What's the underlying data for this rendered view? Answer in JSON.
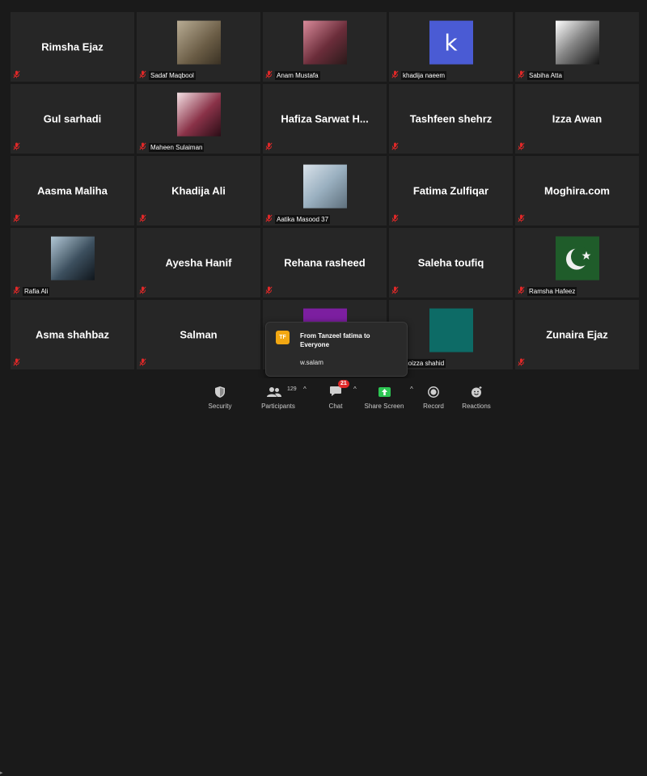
{
  "participants": [
    {
      "name": "Rimsha Ejaz",
      "avatar": null,
      "caption": null
    },
    {
      "name": "Sadaf Maqbool",
      "avatar": "photo",
      "caption": "Sadaf Maqbool"
    },
    {
      "name": "Anam Mustafa",
      "avatar": "photo",
      "caption": "Anam Mustafa"
    },
    {
      "name": "khadija naeem",
      "avatar": "letter",
      "letter": "k",
      "caption": "khadija naeem"
    },
    {
      "name": "Sabiha Atta",
      "avatar": "photo",
      "caption": "Sabiha Atta"
    },
    {
      "name": "Gul sarhadi",
      "avatar": null,
      "caption": null
    },
    {
      "name": "Maheen Sulaiman",
      "avatar": "photo",
      "caption": "Maheen Sulaiman"
    },
    {
      "name": "Hafiza Sarwat H...",
      "avatar": null,
      "caption": null
    },
    {
      "name": "Tashfeen shehrz",
      "avatar": null,
      "caption": null
    },
    {
      "name": "Izza Awan",
      "avatar": null,
      "caption": null
    },
    {
      "name": "Aasma Maliha",
      "avatar": null,
      "caption": null
    },
    {
      "name": "Khadija Ali",
      "avatar": null,
      "caption": null
    },
    {
      "name": "Aatika Masood 37",
      "avatar": "photo",
      "caption": "Aatika Masood 37"
    },
    {
      "name": "Fatima Zulfiqar",
      "avatar": null,
      "caption": null
    },
    {
      "name": "Moghira.com",
      "avatar": null,
      "caption": null
    },
    {
      "name": "Rafia Ali",
      "avatar": "photo",
      "caption": "Rafia Ali"
    },
    {
      "name": "Ayesha Hanif",
      "avatar": null,
      "caption": null
    },
    {
      "name": "Rehana rasheed",
      "avatar": null,
      "caption": null
    },
    {
      "name": "Saleha toufiq",
      "avatar": null,
      "caption": null
    },
    {
      "name": "Ramsha Hafeez",
      "avatar": "photo",
      "caption": "Ramsha Hafeez"
    },
    {
      "name": "Asma shahbaz",
      "avatar": null,
      "caption": null
    },
    {
      "name": "Salman",
      "avatar": null,
      "caption": null
    },
    {
      "name": "",
      "avatar": "color",
      "caption": null
    },
    {
      "name": "",
      "avatar": "color",
      "caption": "moizza shahid"
    },
    {
      "name": "Zunaira Ejaz",
      "avatar": null,
      "caption": null
    }
  ],
  "avatar_colors": {
    "khadija naeem": "#4a5bd4",
    "tile_row5_col3": "#7c1fa0",
    "moizza shahid": "#0d6b66"
  },
  "chat_popup": {
    "avatar_initials": "TF",
    "sender_line": "From Tanzeel fatima to Everyone",
    "message": "w.salam"
  },
  "toolbar": {
    "security": {
      "label": "Security",
      "icon": "shield-icon"
    },
    "participants": {
      "label": "Participants",
      "count": "129",
      "icon": "participants-icon"
    },
    "chat": {
      "label": "Chat",
      "badge": "21",
      "icon": "chat-icon"
    },
    "share_screen": {
      "label": "Share Screen",
      "icon": "share-screen-icon",
      "color": "#2dc653"
    },
    "record": {
      "label": "Record",
      "icon": "record-icon"
    },
    "reactions": {
      "label": "Reactions",
      "icon": "reactions-icon"
    }
  }
}
